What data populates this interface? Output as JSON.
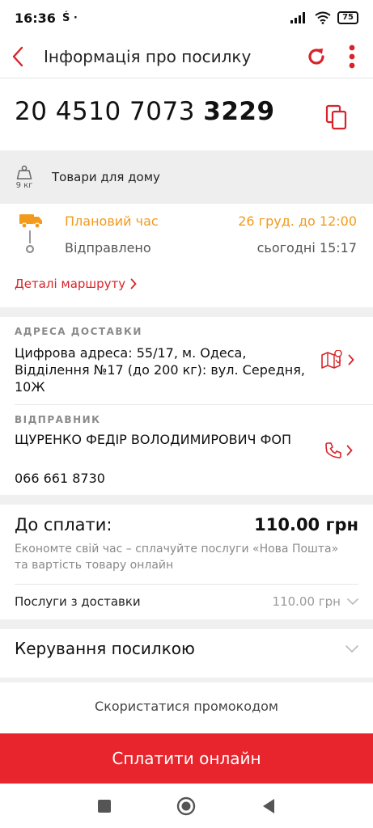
{
  "status_bar": {
    "time": "16:36",
    "extra": "Ś  ·",
    "battery": "75"
  },
  "header": {
    "title": "Інформація про посилку"
  },
  "parcel": {
    "number_main": "20 4510 7073 ",
    "number_bold": "3229",
    "weight": "9 кг",
    "goods": "Товари для дому"
  },
  "schedule": {
    "planned_label": "Плановий час",
    "planned_value": "26 груд. до 12:00",
    "sent_label": "Відправлено",
    "sent_value": "сьогодні 15:17",
    "route_details": "Деталі маршруту"
  },
  "delivery": {
    "label": "АДРЕСА ДОСТАВКИ",
    "address": "Цифрова адреса: 55/17, м. Одеса, Відділення №17 (до 200 кг): вул. Середня, 10Ж"
  },
  "sender": {
    "label": "ВІДПРАВНИК",
    "name": "ЩУРЕНКО ФЕДІР ВОЛОДИМИРОВИЧ ФОП",
    "phone": "066 661 8730"
  },
  "payment": {
    "label": "До сплати:",
    "amount": "110.00 грн",
    "note": "Економте свій час – сплачуйте послуги «Нова Пошта» та вартість товару онлайн",
    "services_label": "Послуги з доставки",
    "services_value": "110.00 грн"
  },
  "manage": {
    "title": "Керування посилкою"
  },
  "promo": {
    "label": "Скористатися промокодом"
  },
  "pay_button": {
    "label": "Сплатити онлайн"
  },
  "colors": {
    "brand_red": "#e8242d",
    "accent_orange": "#f29a1b"
  },
  "icons": [
    "back-arrow-icon",
    "refresh-icon",
    "more-vertical-icon",
    "copy-icon",
    "weight-icon",
    "truck-icon",
    "map-icon",
    "phone-icon",
    "chevron-right-icon",
    "chevron-down-icon"
  ]
}
